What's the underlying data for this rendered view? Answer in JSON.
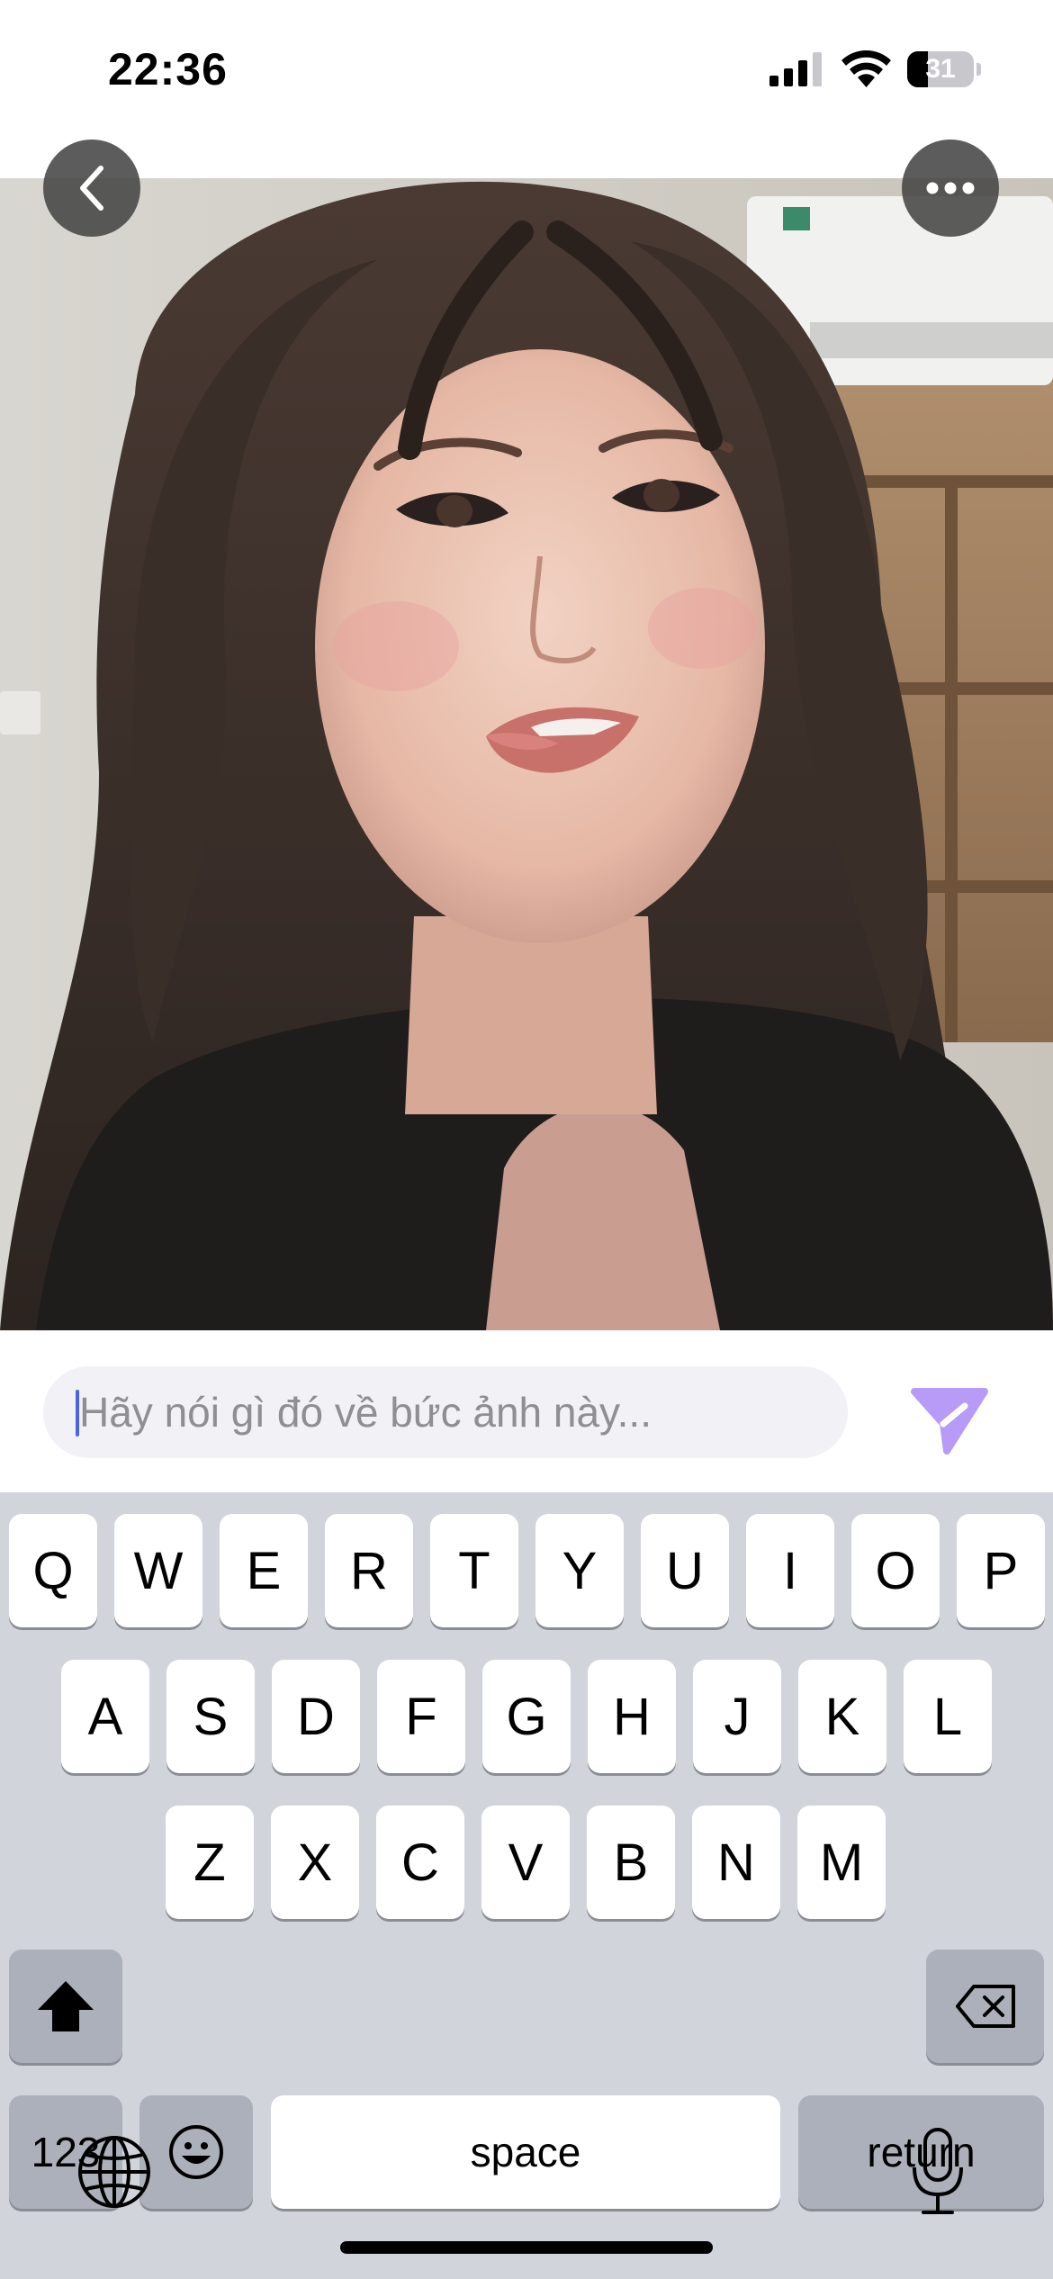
{
  "status_bar": {
    "time": "22:36",
    "battery": "31",
    "battery_level": 0.31
  },
  "header": {
    "back_icon": "chevron-left-icon",
    "more_icon": "ellipsis-icon"
  },
  "photo": {
    "subject": "selfie-photo"
  },
  "comment": {
    "placeholder": "Hãy nói gì đó về bức ảnh này...",
    "send_icon": "send-arrow-icon",
    "send_color": "#b79bf7"
  },
  "keyboard": {
    "row1": [
      "Q",
      "W",
      "E",
      "R",
      "T",
      "Y",
      "U",
      "I",
      "O",
      "P"
    ],
    "row2": [
      "A",
      "S",
      "D",
      "F",
      "G",
      "H",
      "J",
      "K",
      "L"
    ],
    "row3": [
      "Z",
      "X",
      "C",
      "V",
      "B",
      "N",
      "M"
    ],
    "numbers_key": "123",
    "space_key": "space",
    "return_key": "return",
    "icons": [
      "shift-icon",
      "backspace-icon",
      "emoji-icon",
      "globe-icon",
      "microphone-icon"
    ]
  }
}
